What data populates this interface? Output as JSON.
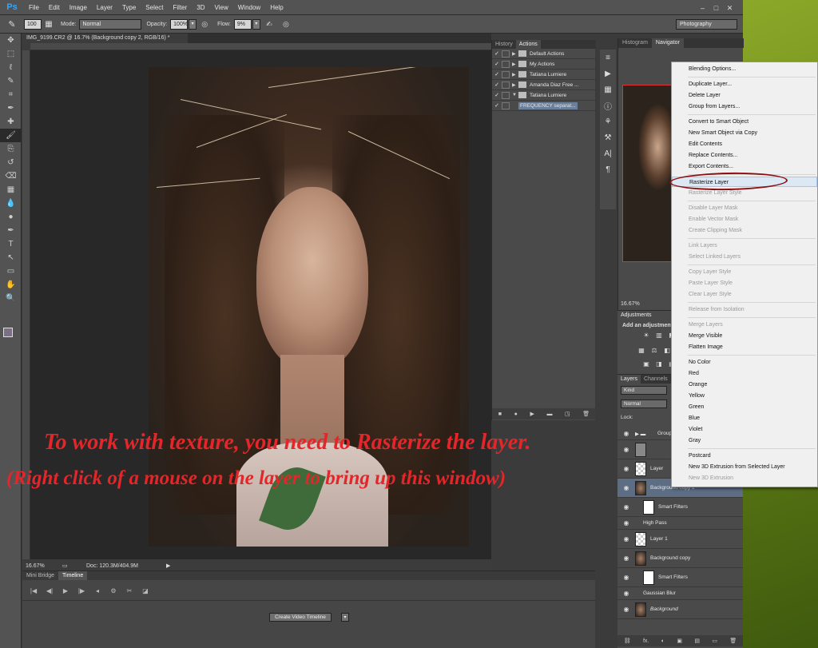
{
  "app": {
    "logo": "Ps",
    "menu": [
      "File",
      "Edit",
      "Image",
      "Layer",
      "Type",
      "Select",
      "Filter",
      "3D",
      "View",
      "Window",
      "Help"
    ],
    "window_controls": [
      "–",
      "□",
      "✕"
    ]
  },
  "options": {
    "brush_size": "100",
    "mode_label": "Mode:",
    "mode_value": "Normal",
    "opacity_label": "Opacity:",
    "opacity_value": "100%",
    "flow_label": "Flow:",
    "flow_value": "9%",
    "workspace": "Photography"
  },
  "document": {
    "tab_title": "IMG_9199.CR2 @ 16.7% (Background copy 2, RGB/16) *",
    "zoom": "16.67%",
    "doc_info": "Doc: 120.3M/404.9M"
  },
  "overlay": {
    "line1": "To work with texture, you need to Rasterize the layer.",
    "line2": "(Right click of a mouse on the layer to bring up this window)",
    "color": "#e4262a"
  },
  "timeline": {
    "tabs": [
      "Mini Bridge",
      "Timeline"
    ],
    "create_button": "Create Video Timeline"
  },
  "actions_panel": {
    "tabs": [
      "History",
      "Actions"
    ],
    "rows": [
      {
        "label": "Default Actions",
        "checked": true,
        "expanded": false,
        "selected": false
      },
      {
        "label": "My Actions",
        "checked": true,
        "expanded": false,
        "selected": false
      },
      {
        "label": "Tatiana Lumiere",
        "checked": true,
        "expanded": false,
        "selected": false
      },
      {
        "label": "Amanda Diaz Free ...",
        "checked": true,
        "expanded": false,
        "selected": false
      },
      {
        "label": "Tatiana Lumiere",
        "checked": true,
        "expanded": true,
        "selected": false
      },
      {
        "label": "FREQUENCY separat...",
        "checked": true,
        "expanded": false,
        "selected": true
      }
    ]
  },
  "navigator": {
    "tabs": [
      "Histogram",
      "Navigator"
    ],
    "zoom": "16.67%"
  },
  "adjustments": {
    "tab": "Adjustments",
    "title": "Add an adjustment"
  },
  "layers": {
    "tabs": [
      "Layers",
      "Channels"
    ],
    "kind": "Kind",
    "blend": "Normal",
    "lock_label": "Lock:",
    "rows": [
      {
        "name": "Group",
        "type": "group"
      },
      {
        "name": "",
        "type": "adjust"
      },
      {
        "name": "Layer",
        "type": "pixel"
      },
      {
        "name": "Background copy 2",
        "type": "smart",
        "selected": true
      },
      {
        "name": "Smart Filters",
        "type": "sub"
      },
      {
        "name": "High Pass",
        "type": "filter"
      },
      {
        "name": "Layer 1",
        "type": "pixel"
      },
      {
        "name": "Background copy",
        "type": "smart"
      },
      {
        "name": "Smart Filters",
        "type": "sub"
      },
      {
        "name": "Gaussian Blur",
        "type": "filter"
      },
      {
        "name": "Background",
        "type": "bg"
      }
    ],
    "footer": [
      "⛓",
      "fx.",
      "◐",
      "▣",
      "▤",
      "▭",
      "🗑"
    ]
  },
  "context_menu": {
    "items": [
      {
        "label": "Blending Options...",
        "disabled": false
      },
      {
        "sep": true
      },
      {
        "label": "Duplicate Layer...",
        "disabled": false
      },
      {
        "label": "Delete Layer",
        "disabled": false
      },
      {
        "label": "Group from Layers...",
        "disabled": false
      },
      {
        "sep": true
      },
      {
        "label": "Convert to Smart Object",
        "disabled": false
      },
      {
        "label": "New Smart Object via Copy",
        "disabled": false
      },
      {
        "label": "Edit Contents",
        "disabled": false
      },
      {
        "label": "Replace Contents...",
        "disabled": false
      },
      {
        "label": "Export Contents...",
        "disabled": false
      },
      {
        "sep": true
      },
      {
        "label": "Rasterize Layer",
        "disabled": false,
        "highlighted": true
      },
      {
        "label": "Rasterize Layer Style",
        "disabled": true
      },
      {
        "sep": true
      },
      {
        "label": "Disable Layer Mask",
        "disabled": true
      },
      {
        "label": "Enable Vector Mask",
        "disabled": true
      },
      {
        "label": "Create Clipping Mask",
        "disabled": true
      },
      {
        "sep": true
      },
      {
        "label": "Link Layers",
        "disabled": true
      },
      {
        "label": "Select Linked Layers",
        "disabled": true
      },
      {
        "sep": true
      },
      {
        "label": "Copy Layer Style",
        "disabled": true
      },
      {
        "label": "Paste Layer Style",
        "disabled": true
      },
      {
        "label": "Clear Layer Style",
        "disabled": true
      },
      {
        "sep": true
      },
      {
        "label": "Release from Isolation",
        "disabled": true
      },
      {
        "sep": true
      },
      {
        "label": "Merge Layers",
        "disabled": true
      },
      {
        "label": "Merge Visible",
        "disabled": false
      },
      {
        "label": "Flatten Image",
        "disabled": false
      },
      {
        "sep": true
      },
      {
        "label": "No Color",
        "disabled": false
      },
      {
        "label": "Red",
        "disabled": false
      },
      {
        "label": "Orange",
        "disabled": false
      },
      {
        "label": "Yellow",
        "disabled": false
      },
      {
        "label": "Green",
        "disabled": false
      },
      {
        "label": "Blue",
        "disabled": false
      },
      {
        "label": "Violet",
        "disabled": false
      },
      {
        "label": "Gray",
        "disabled": false
      },
      {
        "sep": true
      },
      {
        "label": "Postcard",
        "disabled": false
      },
      {
        "label": "New 3D Extrusion from Selected Layer",
        "disabled": false
      },
      {
        "label": "New 3D Extrusion",
        "disabled": true
      }
    ],
    "annotation_color": "#8b0f12"
  },
  "tools": [
    "move-tool",
    "marquee-tool",
    "lasso-tool",
    "quick-select-tool",
    "crop-tool",
    "eyedropper-tool",
    "healing-tool",
    "brush-tool",
    "clone-stamp-tool",
    "history-brush-tool",
    "eraser-tool",
    "gradient-tool",
    "blur-tool",
    "dodge-tool",
    "pen-tool",
    "type-tool",
    "path-select-tool",
    "rectangle-tool",
    "hand-tool",
    "zoom-tool"
  ]
}
